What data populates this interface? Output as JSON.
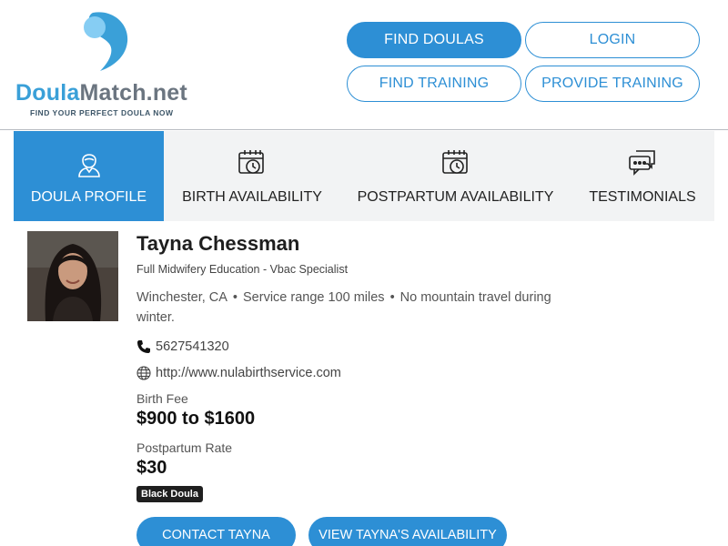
{
  "brand": {
    "name_part1": "Doula",
    "name_part2": "Match.net",
    "tagline": "FIND YOUR PERFECT DOULA NOW",
    "color_primary": "#2d8fd5",
    "color_logo": "#3aa0d8"
  },
  "nav": {
    "find_doulas": "FIND DOULAS",
    "login": "LOGIN",
    "find_training": "FIND TRAINING",
    "provide_training": "PROVIDE TRAINING"
  },
  "tabs": [
    {
      "label": "DOULA PROFILE",
      "icon": "person-icon",
      "active": true
    },
    {
      "label": "BIRTH AVAILABILITY",
      "icon": "calendar-clock-icon",
      "active": false
    },
    {
      "label": "POSTPARTUM AVAILABILITY",
      "icon": "calendar-clock-icon",
      "active": false
    },
    {
      "label": "TESTIMONIALS",
      "icon": "chat-bubbles-icon",
      "active": false
    }
  ],
  "profile": {
    "name": "Tayna Chessman",
    "specialty": "Full Midwifery Education - Vbac Specialist",
    "location": "Winchester, CA",
    "service_range": "Service range 100 miles",
    "travel_note": "No mountain travel during winter.",
    "phone": "5627541320",
    "website": "http://www.nulabirthservice.com",
    "birth_fee_label": "Birth Fee",
    "birth_fee": "$900 to $1600",
    "postpartum_label": "Postpartum Rate",
    "postpartum_rate": "$30",
    "badge": "Black Doula"
  },
  "actions": {
    "contact": "CONTACT TAYNA",
    "availability": "VIEW TAYNA'S AVAILABILITY"
  }
}
